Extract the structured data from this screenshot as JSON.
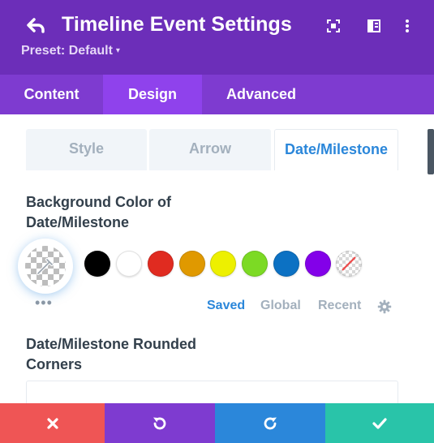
{
  "header": {
    "title": "Timeline Event Settings",
    "preset_label": "Preset: Default",
    "caret": "▾",
    "icons": [
      "back-arrow-icon",
      "focus-icon",
      "split-view-icon",
      "more-vertical-icon"
    ],
    "bg_color": "#6c2eb9"
  },
  "tabs": [
    {
      "label": "Content",
      "active": false
    },
    {
      "label": "Design",
      "active": true
    },
    {
      "label": "Advanced",
      "active": false
    }
  ],
  "subtabs": [
    {
      "label": "Style",
      "active": false
    },
    {
      "label": "Arrow",
      "active": false
    },
    {
      "label": "Date/Milestone",
      "active": true
    }
  ],
  "bg_color_setting": {
    "label": "Background Color of Date/Milestone",
    "current_value": "transparent",
    "more_label": "•••",
    "swatches": [
      {
        "name": "black",
        "color": "#000000"
      },
      {
        "name": "white",
        "color": "#ffffff"
      },
      {
        "name": "red",
        "color": "#e02b20"
      },
      {
        "name": "orange",
        "color": "#e09900"
      },
      {
        "name": "yellow",
        "color": "#edf000"
      },
      {
        "name": "green",
        "color": "#7cda24"
      },
      {
        "name": "blue",
        "color": "#0c71c3"
      },
      {
        "name": "purple",
        "color": "#8300e9"
      },
      {
        "name": "none",
        "color": "transparent"
      }
    ],
    "palette_tabs": [
      {
        "label": "Saved",
        "active": true
      },
      {
        "label": "Global",
        "active": false
      },
      {
        "label": "Recent",
        "active": false
      }
    ]
  },
  "rounded_corners": {
    "label": "Date/Milestone Rounded Corners"
  },
  "footer": {
    "buttons": [
      {
        "name": "discard",
        "color": "#ef5555"
      },
      {
        "name": "undo",
        "color": "#7e3bd0"
      },
      {
        "name": "redo",
        "color": "#2b87da"
      },
      {
        "name": "save",
        "color": "#29c4a9"
      }
    ]
  },
  "colors": {
    "accent_blue": "#2b87da",
    "text_dark": "#33404c",
    "text_muted": "#a3b0bd"
  }
}
